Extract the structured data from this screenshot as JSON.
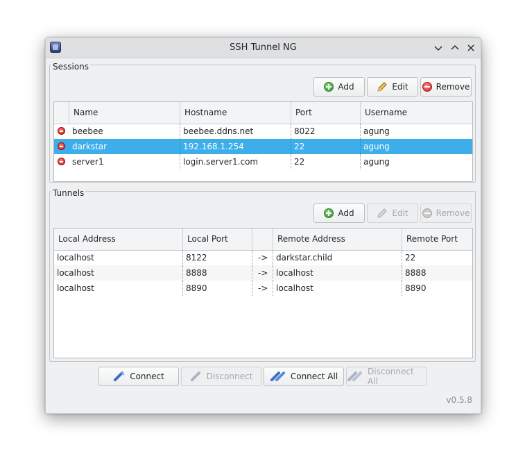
{
  "window": {
    "title": "SSH Tunnel NG"
  },
  "sessions": {
    "label": "Sessions",
    "buttons": {
      "add": "Add",
      "edit": "Edit",
      "remove": "Remove"
    },
    "columns": [
      "",
      "Name",
      "Hostname",
      "Port",
      "Username"
    ],
    "rows": [
      {
        "name": "beebee",
        "hostname": "beebee.ddns.net",
        "port": "8022",
        "username": "agung",
        "status": "disconnected"
      },
      {
        "name": "darkstar",
        "hostname": "192.168.1.254",
        "port": "22",
        "username": "agung",
        "status": "disconnected",
        "selected": true
      },
      {
        "name": "server1",
        "hostname": "login.server1.com",
        "port": "22",
        "username": "agung",
        "status": "disconnected"
      }
    ]
  },
  "tunnels": {
    "label": "Tunnels",
    "buttons": {
      "add": "Add",
      "edit": "Edit",
      "remove": "Remove"
    },
    "columns": [
      "Local Address",
      "Local Port",
      "",
      "Remote Address",
      "Remote Port"
    ],
    "rows": [
      {
        "local_address": "localhost",
        "local_port": "8122",
        "arrow": "->",
        "remote_address": "darkstar.child",
        "remote_port": "22"
      },
      {
        "local_address": "localhost",
        "local_port": "8888",
        "arrow": "->",
        "remote_address": "localhost",
        "remote_port": "8888"
      },
      {
        "local_address": "localhost",
        "local_port": "8890",
        "arrow": "->",
        "remote_address": "localhost",
        "remote_port": "8890"
      }
    ]
  },
  "actions": {
    "connect": "Connect",
    "disconnect": "Disconnect",
    "connect_all": "Connect All",
    "disconnect_all": "Disconnect All"
  },
  "version": "v0.5.8",
  "colors": {
    "selection": "#3daee9",
    "status_disconnected": "#d02020",
    "add_green": "#2f8f2f"
  }
}
